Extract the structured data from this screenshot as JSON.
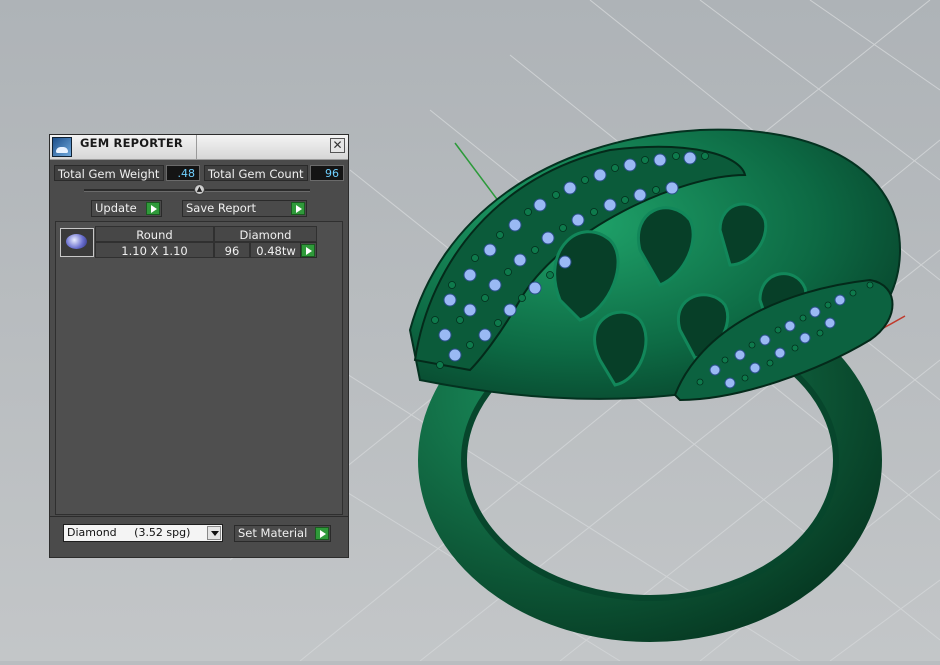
{
  "panel": {
    "title": "GEM REPORTER",
    "close_glyph": "✕",
    "total_weight_label": "Total Gem Weight",
    "total_weight_value": ".48",
    "total_count_label": "Total Gem Count",
    "total_count_value": "96",
    "update_label": "Update",
    "save_report_label": "Save Report",
    "gem_row": {
      "shape": "Round",
      "size": "1.10 X 1.10",
      "material": "Diamond",
      "count": "96",
      "weight": "0.48tw"
    },
    "material_select_value": "Diamond     (3.52 spg)",
    "set_material_label": "Set Material"
  },
  "colors": {
    "viewport_bg": "#b9bdc0",
    "ring_green": "#0f6b45",
    "gem_blue": "#8fb2f0",
    "accent_green_button": "#2f9a3a",
    "value_text": "#6fd0ff"
  },
  "icons": {
    "app_logo": "gem-reporter-logo-icon",
    "gem_thumbnail": "round-gem-icon"
  }
}
